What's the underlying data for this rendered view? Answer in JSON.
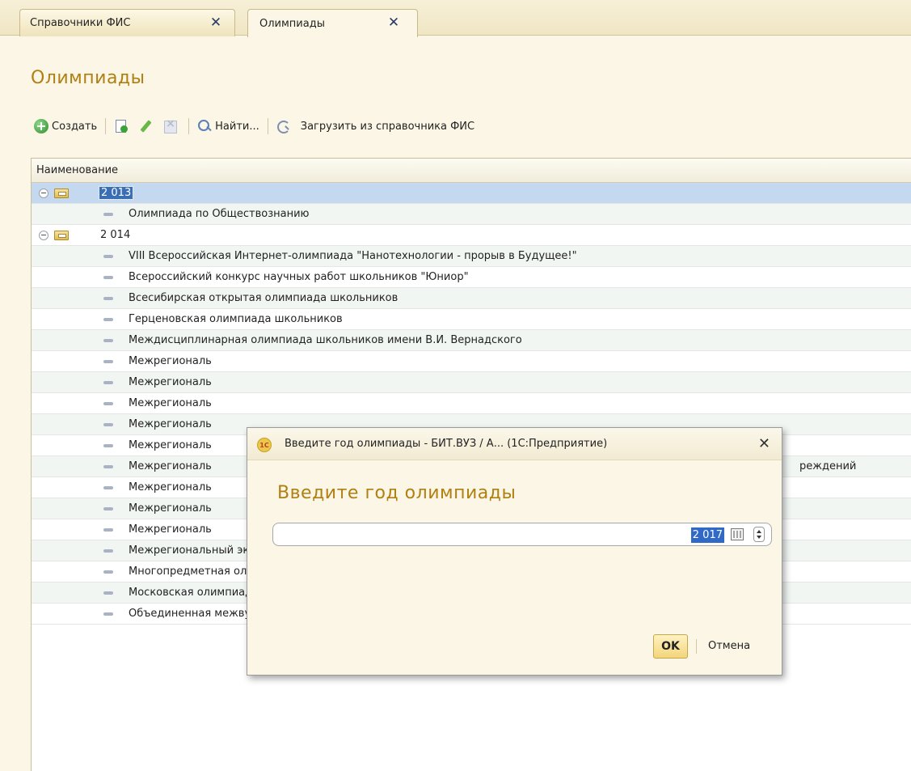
{
  "tabs": [
    {
      "label": "Справочники ФИС",
      "active": false
    },
    {
      "label": "Олимпиады",
      "active": true
    }
  ],
  "page_title": "Олимпиады",
  "toolbar": {
    "create_label": "Создать",
    "find_label": "Найти...",
    "load_label": "Загрузить из справочника ФИС"
  },
  "table": {
    "column_header": "Наименование",
    "groups": [
      {
        "label": "2 013",
        "items": [
          "Олимпиада по Обществознанию"
        ]
      },
      {
        "label": "2 014",
        "items": [
          "VIII Всероссийская Интернет-олимпиада \"Нанотехнологии - прорыв в Будущее!\"",
          "Всероссийский конкурс научных работ школьников \"Юниор\"",
          "Всесибирская открытая олимпиада школьников",
          "Герценовская олимпиада школьников",
          "Междисциплинарная олимпиада школьников имени В.И. Вернадского",
          "Межрегиональ",
          "Межрегиональ",
          "Межрегиональ",
          "Межрегиональ",
          "Межрегиональ",
          "Межрегиональ",
          "Межрегиональ",
          "Межрегиональ",
          "Межрегиональ",
          "Межрегиональный экономический фестиваль школьников \"Сибириада. Шаг в мечту\"",
          "Многопредметная олимпиада \"Юные таланты\"",
          "Московская олимпиада школьников",
          "Объединенная межвузовская математическая олимпиада"
        ]
      }
    ],
    "partial_text_right": "реждений"
  },
  "dialog": {
    "title": "Введите год олимпиады - БИТ.ВУЗ / А... (1С:Предприятие)",
    "logo_text": "1С",
    "heading": "Введите год олимпиады",
    "year_value": "2 017",
    "ok_label": "OK",
    "cancel_label": "Отмена"
  }
}
